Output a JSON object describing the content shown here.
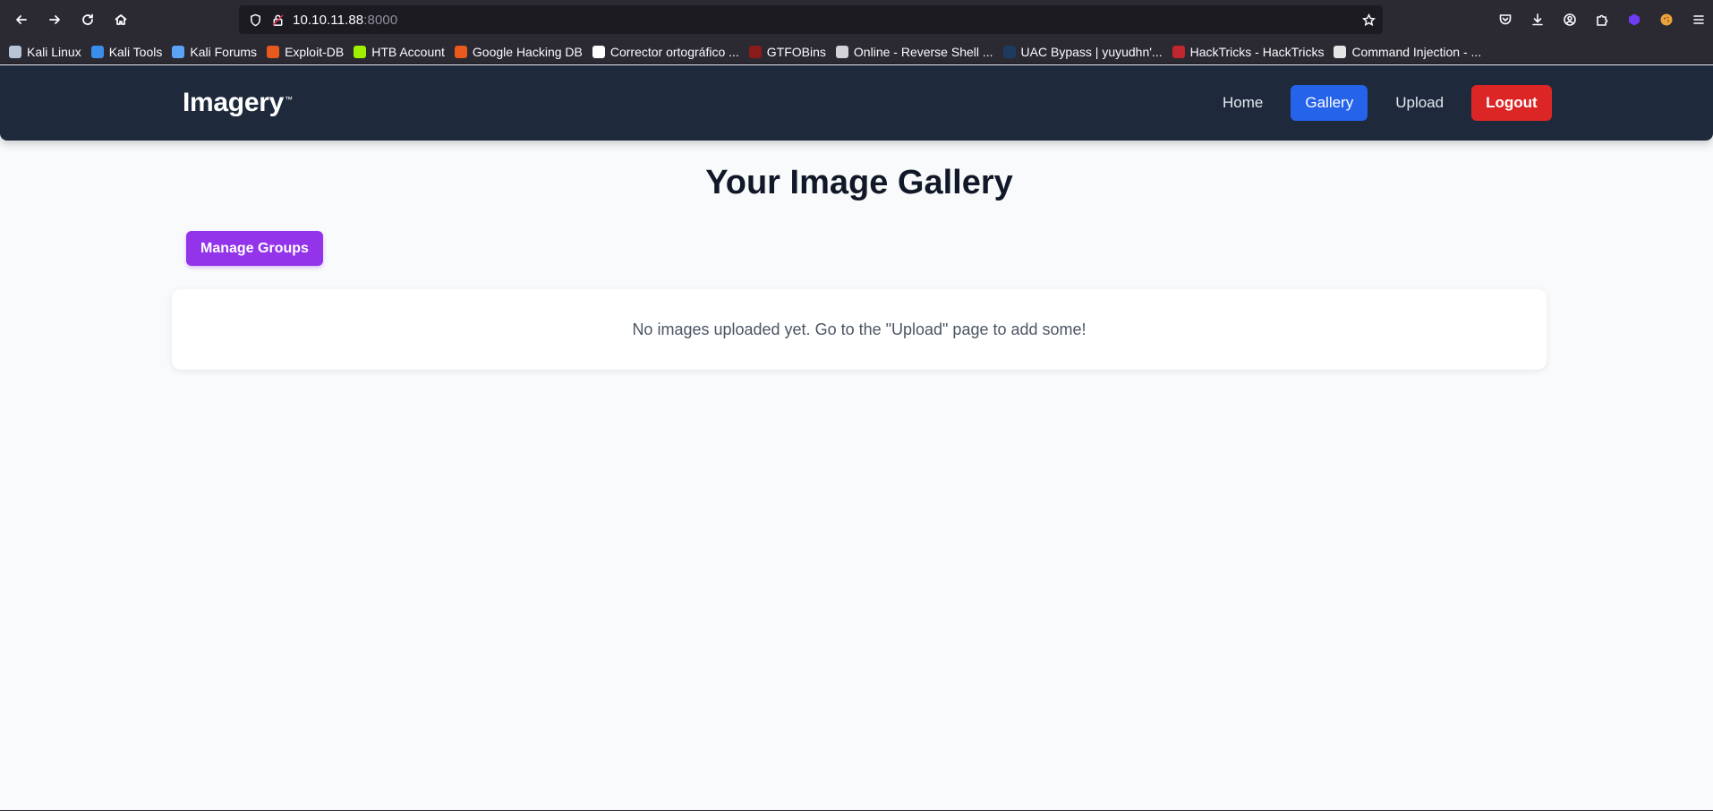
{
  "browser": {
    "url_host": "10.10.11.88",
    "url_port": ":8000",
    "bookmarks": [
      {
        "label": "Kali Linux",
        "icon": "kali-icon",
        "color": "#b8c4d6"
      },
      {
        "label": "Kali Tools",
        "icon": "kali-tools-icon",
        "color": "#3a8eea"
      },
      {
        "label": "Kali Forums",
        "icon": "kali-forums-icon",
        "color": "#5ba3f5"
      },
      {
        "label": "Exploit-DB",
        "icon": "exploit-db-icon",
        "color": "#e8591c"
      },
      {
        "label": "HTB Account",
        "icon": "htb-icon",
        "color": "#9fef00"
      },
      {
        "label": "Google Hacking DB",
        "icon": "ghdb-icon",
        "color": "#e8591c"
      },
      {
        "label": "Corrector ortográfico ...",
        "icon": "corrector-icon",
        "color": "#ffffff"
      },
      {
        "label": "GTFOBins",
        "icon": "gtfobins-icon",
        "color": "#8b1a1a"
      },
      {
        "label": "Online - Reverse Shell ...",
        "icon": "reverse-shell-icon",
        "color": "#d4d4d8"
      },
      {
        "label": "UAC Bypass | yuyudhn'...",
        "icon": "uac-bypass-icon",
        "color": "#1e3a5f"
      },
      {
        "label": "HackTricks - HackTricks",
        "icon": "hacktricks-icon",
        "color": "#c0262d"
      },
      {
        "label": "Command Injection - ...",
        "icon": "command-injection-icon",
        "color": "#e5e5e5"
      }
    ]
  },
  "site": {
    "logo": "Imagery",
    "logo_mark": "™",
    "nav": {
      "home": "Home",
      "gallery": "Gallery",
      "upload": "Upload",
      "logout": "Logout"
    },
    "colors": {
      "header": "#1e293b",
      "active_nav": "#2563eb",
      "logout": "#dc2626",
      "manage_groups": "#9333ea"
    }
  },
  "main": {
    "title": "Your Image Gallery",
    "manage_groups_label": "Manage Groups",
    "empty_message": "No images uploaded yet. Go to the \"Upload\" page to add some!"
  }
}
